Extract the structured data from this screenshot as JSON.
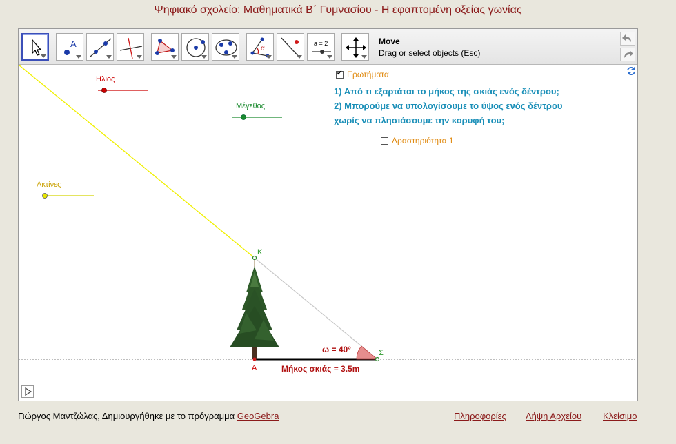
{
  "page": {
    "title": "Ψηφιακό σχολείο: Μαθηματικά Β΄ Γυμνασίου - Η εφαπτομένη οξείας γωνίας"
  },
  "toolbar": {
    "tools": [
      {
        "name": "move-tool",
        "icon": "arrow-cursor-icon"
      },
      {
        "name": "point-tool",
        "icon": "point-icon"
      },
      {
        "name": "line-tool",
        "icon": "line-icon"
      },
      {
        "name": "perpendicular-tool",
        "icon": "perpendicular-icon"
      },
      {
        "name": "polygon-tool",
        "icon": "polygon-icon"
      },
      {
        "name": "circle-tool",
        "icon": "circle-icon"
      },
      {
        "name": "conic-tool",
        "icon": "conic-icon"
      },
      {
        "name": "angle-tool",
        "icon": "angle-icon"
      },
      {
        "name": "reflect-tool",
        "icon": "reflect-icon"
      },
      {
        "name": "slider-tool",
        "icon": "slider-icon",
        "text": "a = 2"
      },
      {
        "name": "move-graphics-tool",
        "icon": "move-graphics-icon"
      }
    ],
    "help_name": "Move",
    "help_desc": "Drag or select objects (Esc)",
    "undo": "undo-icon",
    "redo": "redo-icon"
  },
  "graphics": {
    "sliders": {
      "sun": "Ηλιος",
      "size": "Μέγεθος",
      "rays": "Ακτίνες"
    },
    "checkbox_questions": {
      "label": "Ερωτήματα",
      "checked": true
    },
    "questions": [
      "1) Από τι εξαρτάται το μήκος της σκιάς ενός δέντρου;",
      "2) Μπορούμε να υπολογίσουμε το ύψος ενός δέντρου",
      "χωρίς να πλησιάσουμε την κορυφή του;"
    ],
    "checkbox_activity": {
      "label": "Δραστηριότητα 1",
      "checked": false
    },
    "points": {
      "top": "K",
      "base": "A",
      "shadow_end": "Σ"
    },
    "angle_label": "ω = 40°",
    "shadow_label": "Μήκος σκιάς = 3.5m",
    "colors": {
      "sun": "#cc0000",
      "size": "#1a8a2e",
      "rays": "#e6e600",
      "question": "#1a8fb8",
      "checkbox": "#e08a10"
    }
  },
  "footer": {
    "author_text": "Γιώργος Μαντζώλας, Δημιουργήθηκε με το πρόγραμμα ",
    "geogebra_link": "GeoGebra",
    "info_link": "Πληροφορίες",
    "download_link": "Λήψη Αρχείου",
    "close_link": "Κλείσιμο"
  }
}
